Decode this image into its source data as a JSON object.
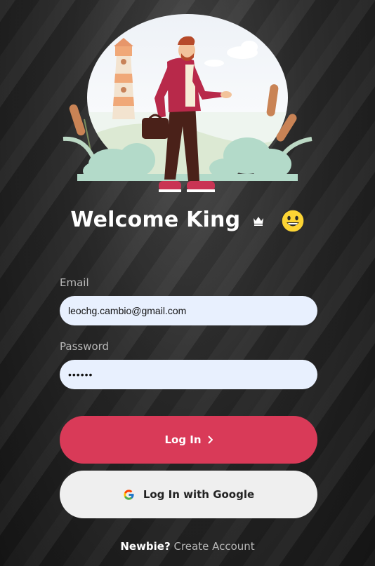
{
  "heading": {
    "text": "Welcome King",
    "icons": [
      "crown-icon",
      "grinning-face-icon"
    ]
  },
  "form": {
    "email_label": "Email",
    "email_value": "leochg.cambio@gmail.com",
    "password_label": "Password",
    "password_value": "••••••"
  },
  "buttons": {
    "login_label": "Log In",
    "google_label": "Log In with Google"
  },
  "footer": {
    "prompt": "Newbie?",
    "link": "Create Account"
  },
  "colors": {
    "accent": "#d93a58",
    "input_bg": "#e8f0fe",
    "google_btn_bg": "#efefef"
  }
}
